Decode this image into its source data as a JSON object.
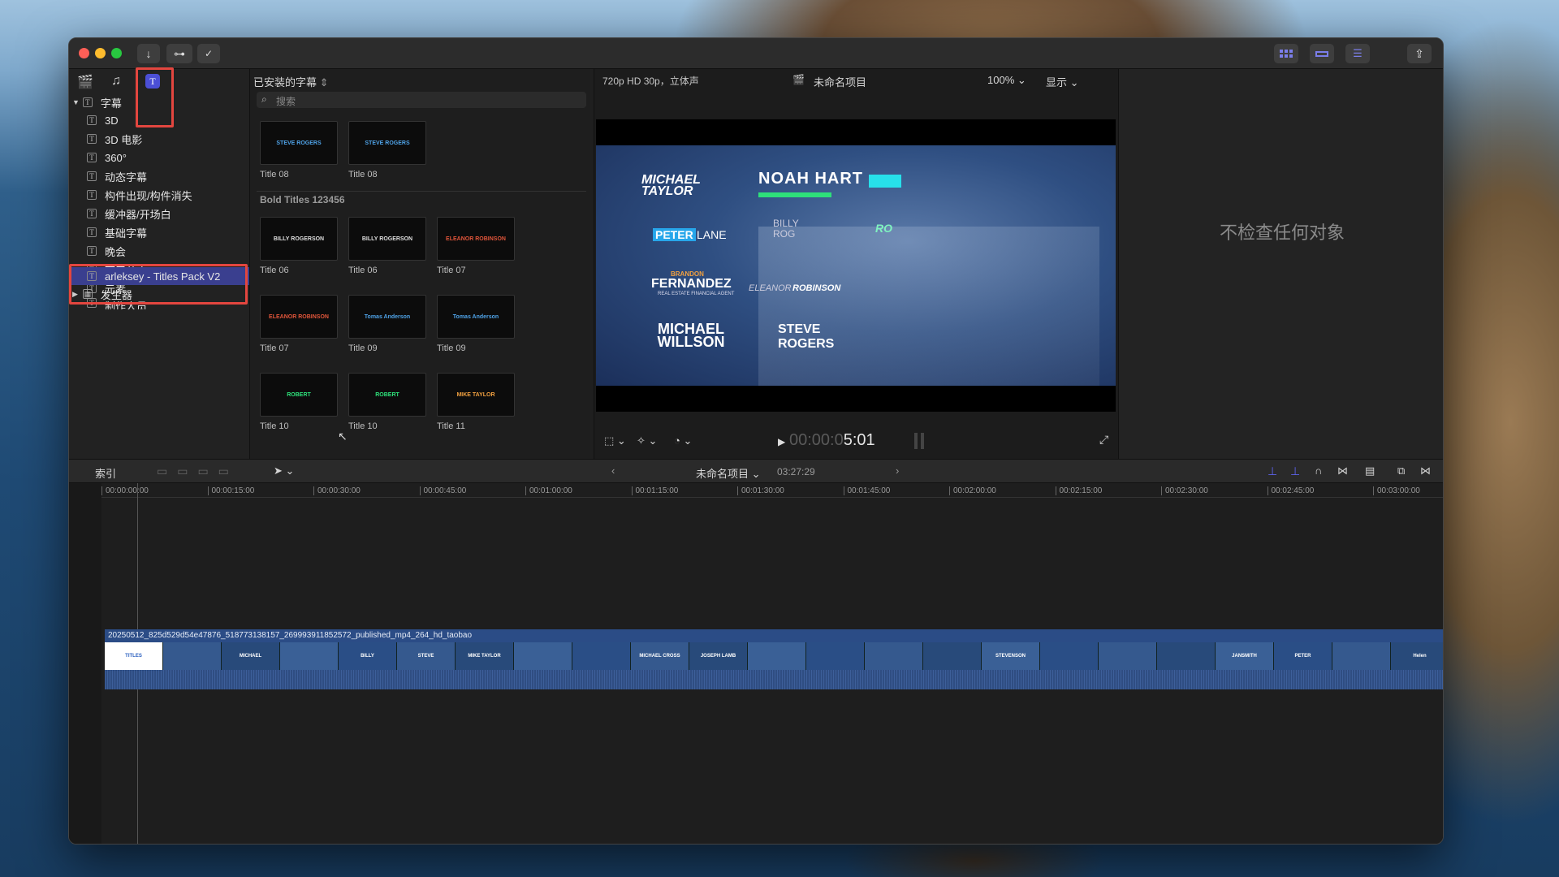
{
  "toolbar": {
    "download_icon": "↓",
    "key_icon": "⊶",
    "check_icon": "✓",
    "share_icon": "⇪"
  },
  "sidebar": {
    "root_label": "字幕",
    "items": [
      "3D",
      "3D 电影",
      "360°",
      "动态字幕",
      "构件出现/构件消失",
      "缓冲器/开场白",
      "基础字幕",
      "晚会",
      "下三分之一",
      "元素",
      "制作人员"
    ],
    "selected_label": "arleksey - Titles Pack V2",
    "generator_label": "发生器"
  },
  "browser": {
    "header": "已安装的字幕",
    "search_placeholder": "搜索",
    "section_title": "Bold Titles 123456",
    "top_row": [
      {
        "label": "Title 08",
        "thumb": "STEVE ROGERS"
      },
      {
        "label": "Title 08",
        "thumb": "STEVE ROGERS"
      }
    ],
    "grid": [
      {
        "label": "Title 06",
        "thumb": "BILLY ROGERSON"
      },
      {
        "label": "Title 06",
        "thumb": "BILLY ROGERSON"
      },
      {
        "label": "Title 07",
        "thumb": "ELEANOR ROBINSON"
      },
      {
        "label": "Title 07",
        "thumb": "ELEANOR ROBINSON"
      },
      {
        "label": "Title 09",
        "thumb": "Tomas Anderson"
      },
      {
        "label": "Title 09",
        "thumb": "Tomas Anderson"
      },
      {
        "label": "Title 10",
        "thumb": "ROBERT"
      },
      {
        "label": "Title 10",
        "thumb": "ROBERT"
      },
      {
        "label": "Title 11",
        "thumb": "MIKE TAYLOR"
      }
    ]
  },
  "viewer": {
    "format": "720p HD 30p，立体声",
    "project": "未命名项目",
    "zoom": "100%",
    "display": "显示",
    "timecode_dim": "00:00:0",
    "timecode": "5:01",
    "preview": {
      "michael_taylor": "MICHAEL TAYLOR",
      "noah_hart": "NOAH HART",
      "peter": "PETER",
      "lane": "LANE",
      "billy": "BILLY ROG",
      "ro": "RO",
      "brandon": "BRANDON",
      "fernandez": "FERNANDEZ",
      "fernandez_sub": "REAL ESTATE FINANCIAL AGENT",
      "eleanor": "ELEANOR",
      "robinson": "ROBINSON",
      "michael_willson": "MICHAEL WILLSON",
      "steve_rogers": "STEVE ROGERS"
    }
  },
  "inspector": {
    "empty": "不检查任何对象"
  },
  "timeline_toolbar": {
    "index": "索引",
    "project": "未命名项目",
    "duration": "03:27:29"
  },
  "ruler": [
    "00:00:00:00",
    "00:00:15:00",
    "00:00:30:00",
    "00:00:45:00",
    "00:01:00:00",
    "00:01:15:00",
    "00:01:30:00",
    "00:01:45:00",
    "00:02:00:00",
    "00:02:15:00",
    "00:02:30:00",
    "00:02:45:00",
    "00:03:00:00"
  ],
  "clip": {
    "name": "20250512_825d529d54e47876_518773138157_269993911852572_published_mp4_264_hd_taobao",
    "frames": [
      "TITLES",
      "",
      "MICHAEL",
      "",
      "BILLY",
      "STEVE",
      "MIKE TAYLOR",
      "",
      "",
      "MICHAEL CROSS",
      "JOSEPH LAMB",
      "",
      "",
      "",
      "",
      "STEVENSON",
      "",
      "",
      "",
      "JANSMITH",
      "PETER",
      "",
      "Helen"
    ]
  },
  "colors": {
    "accent": "#4b4fd6",
    "highlight": "#e3463f",
    "selection": "#3a3f8f"
  }
}
